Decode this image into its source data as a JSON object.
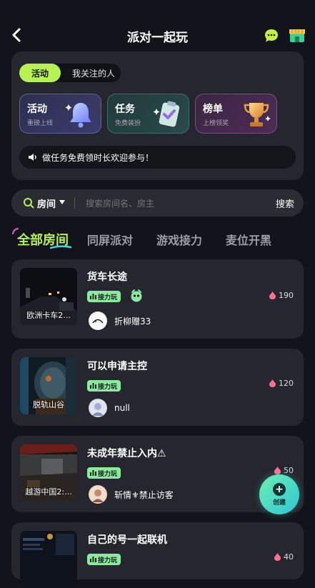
{
  "header": {
    "title": "派对一起玩"
  },
  "panel": {
    "segments": {
      "active": "活动",
      "inactive": "我关注的人"
    },
    "cards": [
      {
        "title": "活动",
        "subtitle": "重磅上线",
        "icon": "bell-icon"
      },
      {
        "title": "任务",
        "subtitle": "免费装扮",
        "icon": "clipboard-check-icon"
      },
      {
        "title": "榜单",
        "subtitle": "上榜领奖",
        "icon": "trophy-icon"
      }
    ],
    "notice": "做任务免费领时长欢迎参与！"
  },
  "search": {
    "scope": "房间",
    "placeholder": "搜索房间名、房主",
    "button": "搜索"
  },
  "tabs": [
    "全部房间",
    "同屏派对",
    "游戏接力",
    "麦位开黑"
  ],
  "rooms": [
    {
      "name": "货车长途",
      "badge": "接力玩",
      "heat": "190",
      "thumb_caption": "欧洲卡车2...",
      "owner": "折柳赠33"
    },
    {
      "name": "可以申请主控",
      "badge": "接力玩",
      "heat": "120",
      "thumb_caption": "脱轨山谷",
      "owner": "null"
    },
    {
      "name": "未成年禁止入内⚠",
      "badge": "接力玩",
      "heat": "50",
      "thumb_caption": "越游中国2:...",
      "owner": "斩情⚜禁止访客"
    },
    {
      "name": "自己的号一起联机",
      "badge": "接力玩",
      "heat": "40",
      "thumb_caption": "",
      "owner": ""
    }
  ],
  "fab": {
    "label": "创建"
  },
  "colors": {
    "accent": "#b8f152",
    "background": "#13141b",
    "card": "#25262e",
    "badge": "#8be9a0"
  }
}
